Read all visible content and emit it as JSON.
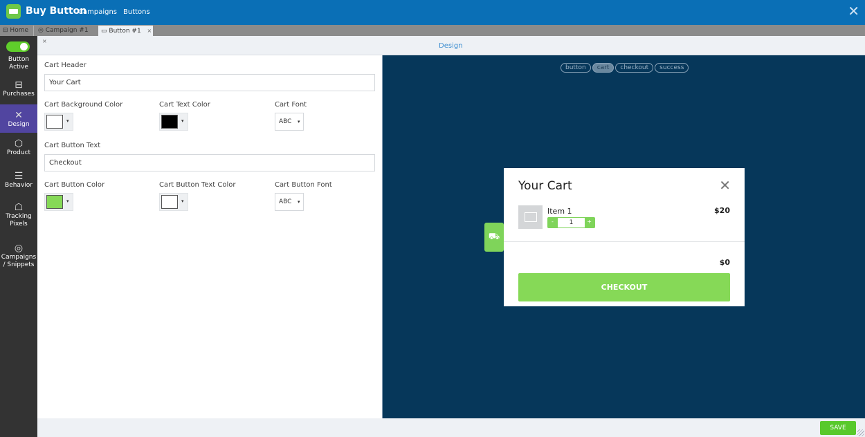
{
  "topbar": {
    "title": "Buy Button",
    "nav": [
      "Campaigns",
      "Buttons"
    ],
    "close_icon": "close-icon"
  },
  "tabs": [
    {
      "label": "Home",
      "icon": "home-icon",
      "closable": false
    },
    {
      "label": "Campaign #1",
      "icon": "campaign-icon",
      "closable": true,
      "close": "×"
    },
    {
      "label": "Button #1",
      "icon": "button-icon",
      "closable": true,
      "close": "×",
      "active": true
    }
  ],
  "sidebar": {
    "toggle": {
      "on": true,
      "label": "Button Active"
    },
    "items": [
      {
        "label": "Purchases",
        "icon": "ticket-icon",
        "glyph": "⊟"
      },
      {
        "label": "Design",
        "icon": "design-tools-icon",
        "glyph": "✕",
        "active": true
      },
      {
        "label": "Product",
        "icon": "box-icon",
        "glyph": "⬡"
      },
      {
        "label": "Behavior",
        "icon": "sliders-icon",
        "glyph": "☰"
      },
      {
        "label": "Tracking Pixels",
        "icon": "ghost-icon",
        "glyph": "☖"
      },
      {
        "label": "Campaigns / Snippets",
        "icon": "target-icon",
        "glyph": "◎"
      }
    ]
  },
  "subheader": {
    "title": "Design"
  },
  "form": {
    "cart_header": {
      "label": "Cart Header",
      "value": "Your Cart"
    },
    "cart_bg_color": {
      "label": "Cart Background Color",
      "value": "#ffffff"
    },
    "cart_text_color": {
      "label": "Cart Text Color",
      "value": "#000000"
    },
    "cart_font": {
      "label": "Cart Font",
      "value": "ABC"
    },
    "cart_button_text": {
      "label": "Cart Button Text",
      "value": "Checkout"
    },
    "cart_button_color": {
      "label": "Cart Button Color",
      "value": "#86d957"
    },
    "cart_button_text_color": {
      "label": "Cart Button Text Color",
      "value": "#ffffff"
    },
    "cart_button_font": {
      "label": "Cart Button Font",
      "value": "ABC"
    },
    "caret": "▾"
  },
  "preview": {
    "pills": [
      {
        "label": "button"
      },
      {
        "label": "cart",
        "active": true
      },
      {
        "label": "checkout"
      },
      {
        "label": "success"
      }
    ],
    "cart_tab_icon": "🛒",
    "cart": {
      "title": "Your Cart",
      "close": "✕",
      "item": {
        "name": "Item 1",
        "qty": "1",
        "minus": "-",
        "plus": "+",
        "price": "$20"
      },
      "total": "$0",
      "checkout_label": "CHECKOUT"
    }
  },
  "footer": {
    "save_label": "SAVE"
  },
  "colors": {
    "topbar": "#0a6fb6",
    "sidebar": "#333333",
    "sidebar_active": "#5145a0",
    "preview_bg": "#06375a",
    "accent_green": "#86d957",
    "save_green": "#58c92b"
  }
}
